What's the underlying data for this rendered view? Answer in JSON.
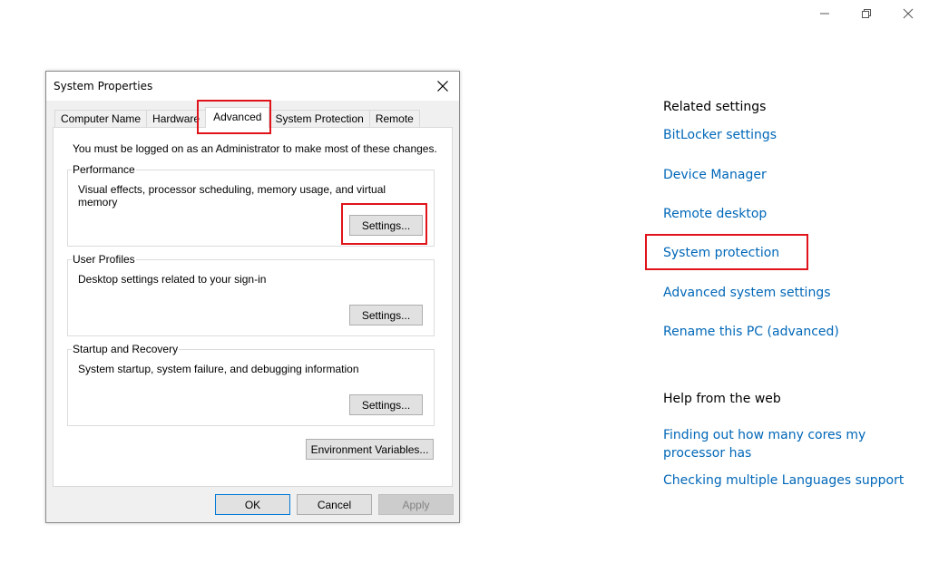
{
  "window_controls": {
    "minimize": "minimize-icon",
    "restore": "restore-icon",
    "close": "close-icon"
  },
  "dialog": {
    "title": "System Properties",
    "close_icon": "close-icon",
    "tabs": [
      {
        "label": "Computer Name",
        "active": false
      },
      {
        "label": "Hardware",
        "active": false
      },
      {
        "label": "Advanced",
        "active": true
      },
      {
        "label": "System Protection",
        "active": false
      },
      {
        "label": "Remote",
        "active": false
      }
    ],
    "admin_note": "You must be logged on as an Administrator to make most of these changes.",
    "groups": [
      {
        "label": "Performance",
        "description": "Visual effects, processor scheduling, memory usage, and virtual memory",
        "button": "Settings..."
      },
      {
        "label": "User Profiles",
        "description": "Desktop settings related to your sign-in",
        "button": "Settings..."
      },
      {
        "label": "Startup and Recovery",
        "description": "System startup, system failure, and debugging information",
        "button": "Settings..."
      }
    ],
    "env_button": "Environment Variables...",
    "footer": {
      "ok": "OK",
      "cancel": "Cancel",
      "apply": "Apply"
    }
  },
  "related_settings": {
    "heading": "Related settings",
    "links": [
      "BitLocker settings",
      "Device Manager",
      "Remote desktop",
      "System protection",
      "Advanced system settings",
      "Rename this PC (advanced)"
    ]
  },
  "help_from_web": {
    "heading": "Help from the web",
    "links": [
      "Finding out how many cores my processor has",
      "Checking multiple Languages support"
    ],
    "link_lines": [
      [
        "Finding out how many cores my",
        "processor has"
      ]
    ]
  },
  "colors": {
    "link": "#0067b8",
    "highlight": "#e0131a",
    "default_button_border": "#0078d7"
  }
}
